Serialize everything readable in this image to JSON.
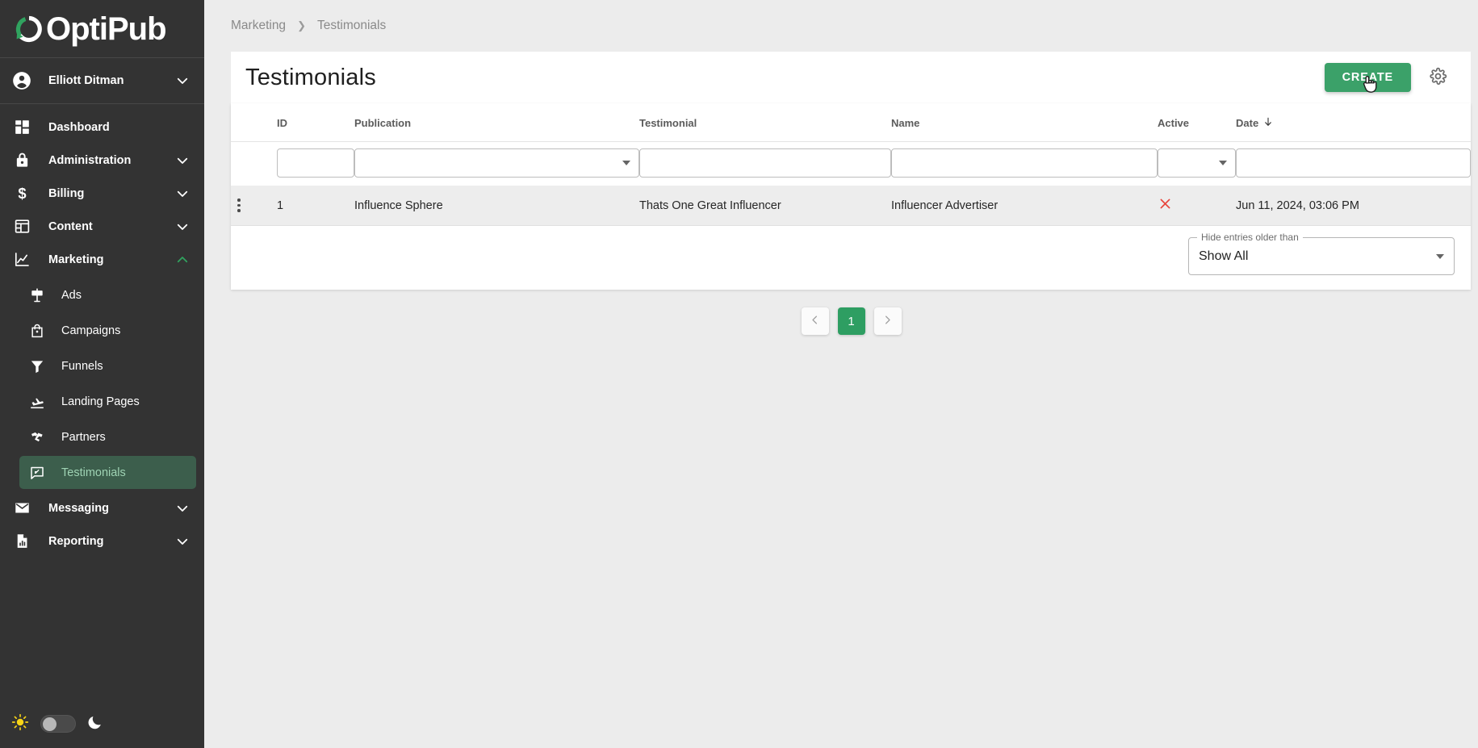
{
  "brand": {
    "name": "OptiPub",
    "logo_icon": "circular-arrow-logo"
  },
  "sidebar": {
    "user": {
      "name": "Elliott Ditman",
      "avatar_icon": "account-circle-icon",
      "chevron_icon": "chevron-down-icon"
    },
    "items": [
      {
        "label": "Dashboard",
        "icon": "dashboard-icon",
        "expandable": false
      },
      {
        "label": "Administration",
        "icon": "lock-icon",
        "expandable": true
      },
      {
        "label": "Billing",
        "icon": "dollar-icon",
        "expandable": true
      },
      {
        "label": "Content",
        "icon": "content-layout-icon",
        "expandable": true
      },
      {
        "label": "Marketing",
        "icon": "chart-line-icon",
        "expandable": true,
        "expanded": true
      }
    ],
    "marketing_children": [
      {
        "label": "Ads",
        "icon": "ad-sign-icon",
        "active": false
      },
      {
        "label": "Campaigns",
        "icon": "shopping-bag-icon",
        "active": false
      },
      {
        "label": "Funnels",
        "icon": "funnel-icon",
        "active": false
      },
      {
        "label": "Landing Pages",
        "icon": "airplane-landing-icon",
        "active": false
      },
      {
        "label": "Partners",
        "icon": "handshake-icon",
        "active": false
      },
      {
        "label": "Testimonials",
        "icon": "comment-edit-icon",
        "active": true
      }
    ],
    "items_after": [
      {
        "label": "Messaging",
        "icon": "envelope-icon",
        "expandable": true
      },
      {
        "label": "Reporting",
        "icon": "file-chart-icon",
        "expandable": true
      }
    ],
    "theme_toggle": {
      "light_icon": "sun-icon",
      "dark_icon": "moon-icon",
      "state": "light"
    }
  },
  "breadcrumb": {
    "items": [
      "Marketing",
      "Testimonials"
    ],
    "separator_icon": "chevron-right-icon"
  },
  "header": {
    "title": "Testimonials",
    "create_label": "CREATE",
    "settings_icon": "gear-icon",
    "cursor_icon": "pointer-hand-cursor"
  },
  "table": {
    "columns": [
      {
        "key": "menu",
        "label": ""
      },
      {
        "key": "id",
        "label": "ID"
      },
      {
        "key": "publication",
        "label": "Publication"
      },
      {
        "key": "testimonial",
        "label": "Testimonial"
      },
      {
        "key": "name",
        "label": "Name"
      },
      {
        "key": "active",
        "label": "Active"
      },
      {
        "key": "date",
        "label": "Date",
        "sort": "desc",
        "sort_icon": "arrow-down-icon"
      }
    ],
    "filters": {
      "id": {
        "type": "text",
        "value": "",
        "placeholder": ""
      },
      "publication": {
        "type": "select",
        "value": "",
        "caret_icon": "caret-down-icon"
      },
      "testimonial": {
        "type": "text",
        "value": "",
        "placeholder": ""
      },
      "name": {
        "type": "text",
        "value": "",
        "placeholder": ""
      },
      "active": {
        "type": "select",
        "value": "",
        "caret_icon": "caret-down-icon"
      },
      "date": {
        "type": "text",
        "value": "",
        "placeholder": ""
      }
    },
    "rows": [
      {
        "menu_icon": "vertical-dots-icon",
        "id": "1",
        "publication": "Influence Sphere",
        "testimonial": "Thats One Great Influencer",
        "name": "Influencer Advertiser",
        "active": false,
        "active_icon": "close-x-icon",
        "date": "Jun 11, 2024, 03:06 PM"
      }
    ]
  },
  "footer_filter": {
    "legend": "Hide entries older than",
    "value": "Show All",
    "caret_icon": "caret-down-icon"
  },
  "pagination": {
    "prev_icon": "chevron-left-icon",
    "next_icon": "chevron-right-icon",
    "pages": [
      "1"
    ],
    "current": "1"
  },
  "colors": {
    "brand_green": "#3ba169",
    "sidebar_bg": "#333333",
    "active_nav_bg": "#3c5e4c",
    "active_nav_text": "#9fd3b4",
    "page_bg": "#ececec",
    "danger_red": "#e53935",
    "id_green": "#1f9d5b"
  }
}
